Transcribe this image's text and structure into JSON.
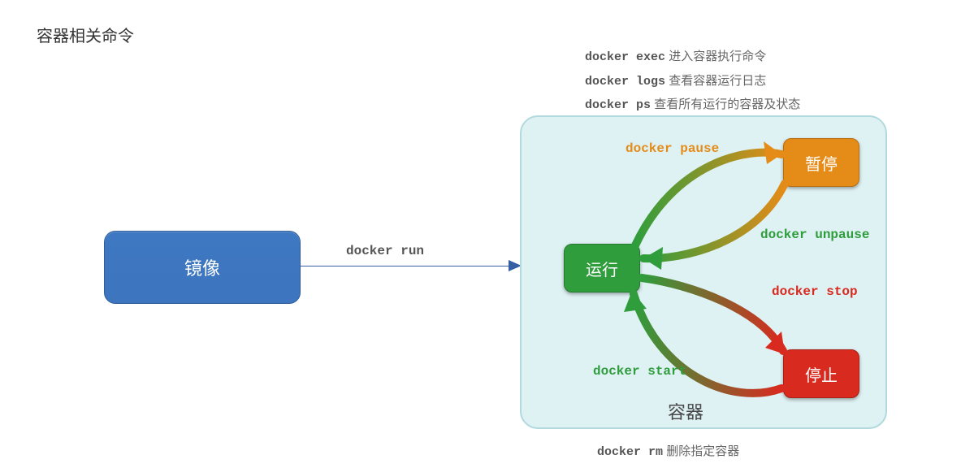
{
  "title": "容器相关命令",
  "notes": {
    "line1_cmd": "docker exec",
    "line1_txt": "进入容器执行命令",
    "line2_cmd": "docker logs",
    "line2_txt": "查看容器运行日志",
    "line3_cmd": "docker ps",
    "line3_txt": "查看所有运行的容器及状态",
    "bottom_cmd": "docker rm",
    "bottom_txt": "删除指定容器"
  },
  "nodes": {
    "image": "镜像",
    "container_label": "容器",
    "run": "运行",
    "pause": "暂停",
    "stop": "停止"
  },
  "edges": {
    "run_cmd": "docker run",
    "pause_cmd": "docker pause",
    "unpause_cmd": "docker unpause",
    "stop_cmd": "docker stop",
    "start_cmd": "docker start"
  },
  "chart_data": {
    "type": "diagram",
    "title": "容器相关命令",
    "nodes": [
      {
        "id": "image",
        "label": "镜像"
      },
      {
        "id": "container",
        "label": "容器"
      },
      {
        "id": "running",
        "label": "运行",
        "parent": "container"
      },
      {
        "id": "paused",
        "label": "暂停",
        "parent": "container"
      },
      {
        "id": "stopped",
        "label": "停止",
        "parent": "container"
      }
    ],
    "edges": [
      {
        "from": "image",
        "to": "container",
        "label": "docker run"
      },
      {
        "from": "running",
        "to": "paused",
        "label": "docker pause"
      },
      {
        "from": "paused",
        "to": "running",
        "label": "docker unpause"
      },
      {
        "from": "running",
        "to": "stopped",
        "label": "docker stop"
      },
      {
        "from": "stopped",
        "to": "running",
        "label": "docker start"
      }
    ],
    "annotations": [
      "docker exec 进入容器执行命令",
      "docker logs 查看容器运行日志",
      "docker ps 查看所有运行的容器及状态",
      "docker rm 删除指定容器"
    ]
  }
}
